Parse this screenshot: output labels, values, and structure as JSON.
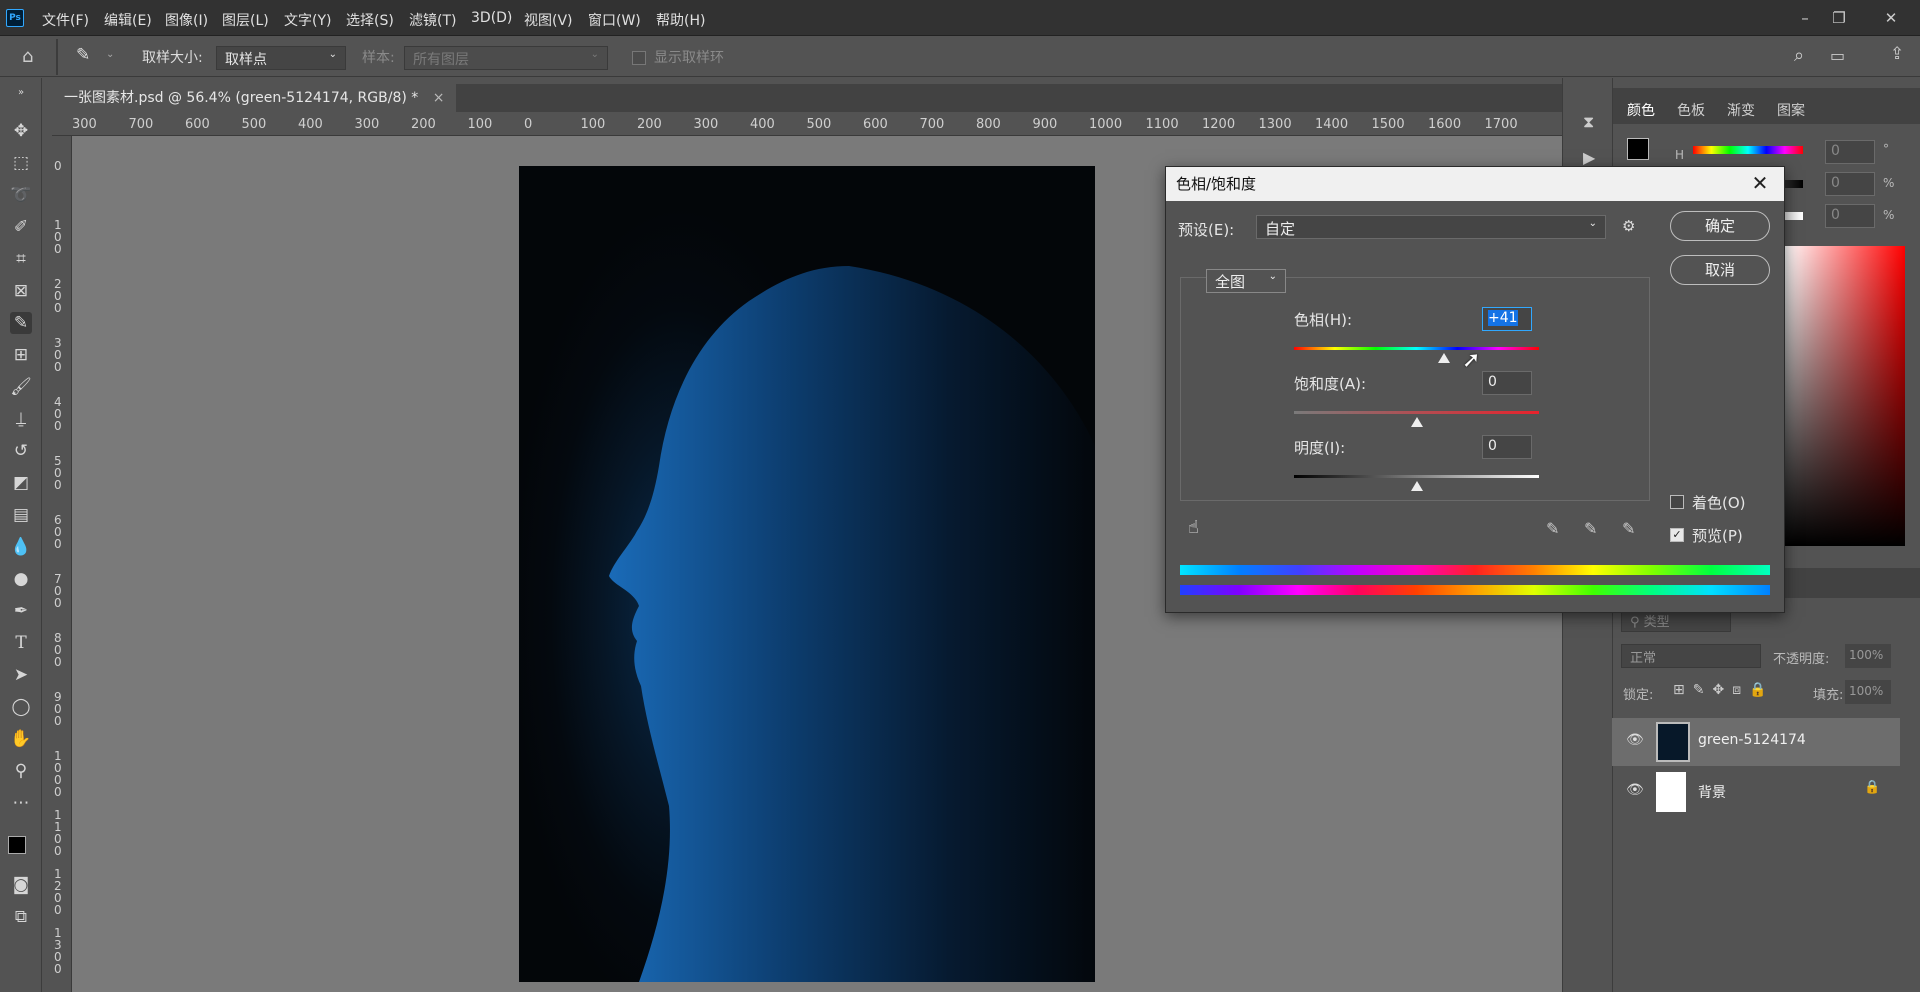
{
  "app": {
    "logo": "Ps"
  },
  "menu": [
    "文件(F)",
    "编辑(E)",
    "图像(I)",
    "图层(L)",
    "文字(Y)",
    "选择(S)",
    "滤镜(T)",
    "3D(D)",
    "视图(V)",
    "窗口(W)",
    "帮助(H)"
  ],
  "options": {
    "sample_size_label": "取样大小:",
    "sample_size_value": "取样点",
    "sample_label": "样本:",
    "sample_value": "所有图层",
    "show_ring_label": "显示取样环"
  },
  "document": {
    "tab_title": "一张图素材.psd @ 56.4% (green-5124174, RGB/8) *",
    "close": "×"
  },
  "ruler_h": [
    "300",
    "700",
    "600",
    "500",
    "400",
    "300",
    "200",
    "100",
    "0",
    "100",
    "200",
    "300",
    "400",
    "500",
    "600",
    "700",
    "800",
    "900",
    "1000",
    "1100",
    "1200",
    "1300",
    "1400",
    "1500",
    "1600",
    "1700"
  ],
  "ruler_v": [
    "0",
    "100",
    "200",
    "300",
    "400",
    "500",
    "600",
    "700",
    "800",
    "900",
    "1000",
    "1100",
    "1200",
    "1300"
  ],
  "right_panel": {
    "tabs": [
      "颜色",
      "色板",
      "渐变",
      "图案"
    ],
    "h_label": "H",
    "color_values": [
      "0",
      "0",
      "0"
    ],
    "units": [
      "°",
      "%",
      "%"
    ],
    "layers_filter": "类型",
    "blend_mode": "正常",
    "opacity_label": "不透明度:",
    "opacity_value": "100%",
    "lock_label": "锁定:",
    "fill_label": "填充:",
    "fill_value": "100%",
    "layers": [
      {
        "name": "green-5124174",
        "selected": true
      },
      {
        "name": "背景",
        "locked": true
      }
    ]
  },
  "dialog": {
    "title": "色相/饱和度",
    "preset_label": "预设(E):",
    "preset_value": "自定",
    "ok": "确定",
    "cancel": "取消",
    "channel": "全图",
    "hue_label": "色相(H):",
    "hue_value": "+41",
    "saturation_label": "饱和度(A):",
    "saturation_value": "0",
    "lightness_label": "明度(I):",
    "lightness_value": "0",
    "colorize_label": "着色(O)",
    "colorize_checked": false,
    "preview_label": "预览(P)",
    "preview_checked": true,
    "hue_slider_fraction": 0.614,
    "sat_slider_fraction": 0.5,
    "light_slider_fraction": 0.5
  }
}
